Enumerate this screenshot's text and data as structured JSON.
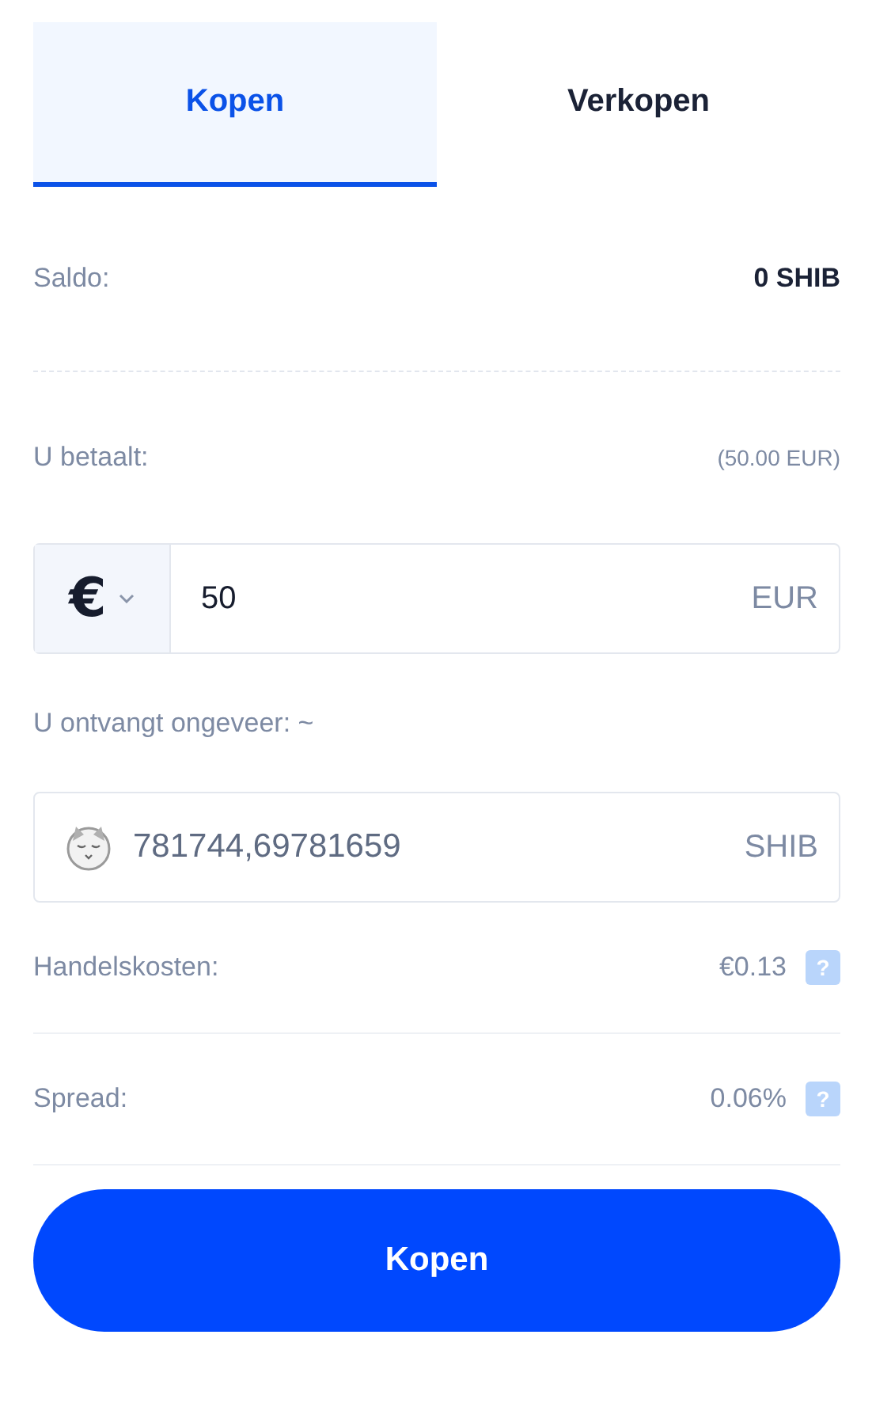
{
  "tabs": [
    {
      "label": "Kopen",
      "selected": true
    },
    {
      "label": "Verkopen",
      "selected": false
    }
  ],
  "balance": {
    "label": "Saldo:",
    "value": "0 SHIB"
  },
  "pay": {
    "label": "U betaalt:",
    "note": "(50.00 EUR)",
    "currency_symbol": "€",
    "value": "50",
    "unit": "EUR"
  },
  "receive": {
    "label": "U ontvangt ongeveer: ~",
    "value": "781744,69781659",
    "unit": "SHIB"
  },
  "fees": [
    {
      "label": "Handelskosten:",
      "value": "€0.13",
      "help": "?"
    },
    {
      "label": "Spread:",
      "value": "0.06%",
      "help": "?"
    }
  ],
  "submit": "Kopen"
}
